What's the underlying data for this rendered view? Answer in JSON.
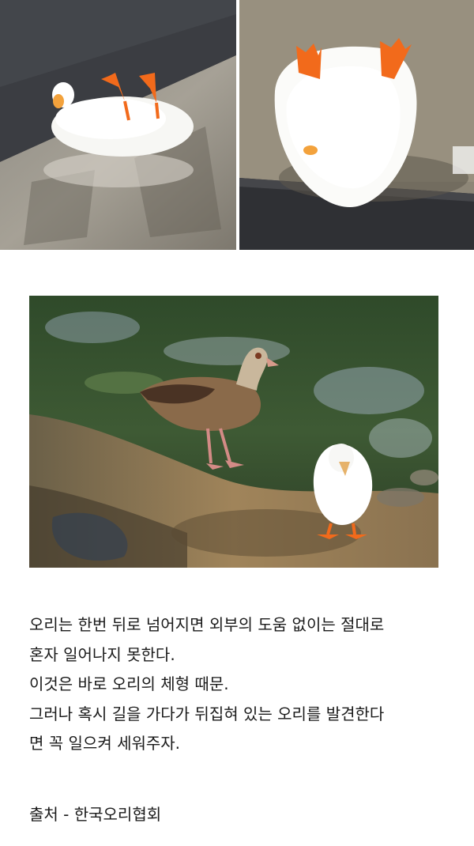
{
  "images": [
    {
      "name": "duck-lying-on-back-side-view"
    },
    {
      "name": "duck-lying-on-back-top-view"
    },
    {
      "name": "egyptian-goose-and-white-duck-by-pond"
    }
  ],
  "caption": {
    "lines": [
      "오리는 한번 뒤로 넘어지면 외부의 도움 없이는 절대로",
      "혼자 일어나지 못한다.",
      "이것은 바로 오리의 체형 때문.",
      "그러나 혹시 길을 가다가 뒤집혀 있는 오리를 발견한다",
      "면 꼭 일으켜 세워주자."
    ],
    "source": "출처 - 한국오리협회"
  },
  "colors": {
    "background": "#ffffff",
    "text": "#1a1a1a",
    "duck_feet": "#f26a1b"
  }
}
